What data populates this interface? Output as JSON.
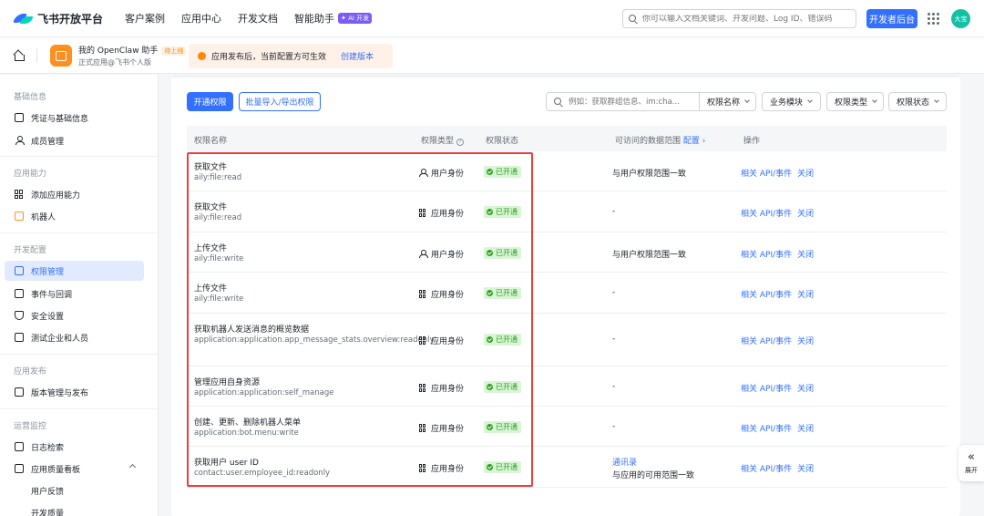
{
  "brand": {
    "name": "飞书开放平台"
  },
  "nav": {
    "items": [
      "客户案例",
      "应用中心",
      "开发文档",
      "智能助手"
    ],
    "ai_badge": "✦ AI 开发"
  },
  "search": {
    "placeholder": "你可以输入文档关键词、开发问题、Log ID、错误码"
  },
  "header": {
    "dev_console": "开发者后台",
    "avatar": "大宝"
  },
  "app": {
    "name": "我的 OpenClaw 助手",
    "tag": "待上线",
    "subtitle": "正式应用@飞书个人版"
  },
  "notice": {
    "text": "应用发布后，当前配置方可生效",
    "link": "创建版本"
  },
  "sidebar": {
    "groups": [
      "基础信息",
      "应用能力",
      "开发配置",
      "应用发布",
      "运营监控"
    ],
    "items": [
      "凭证与基础信息",
      "成员管理",
      "添加应用能力",
      "机器人",
      "权限管理",
      "事件与回调",
      "安全设置",
      "测试企业和人员",
      "版本管理与发布",
      "日志检索",
      "应用质量看板",
      "用户反馈",
      "开发质量"
    ]
  },
  "toolbar": {
    "enable": "开通权限",
    "batch": "批量导入/导出权限",
    "search_placeholder": "例如：获取群组信息、im:cha...",
    "search_scope": "权限名称",
    "filters": [
      "业务模块",
      "权限类型",
      "权限状态"
    ]
  },
  "table": {
    "headers": [
      "权限名称",
      "权限类型",
      "权限状态",
      "可访问的数据范围",
      "配置",
      "操作"
    ],
    "rows": [
      {
        "name": "获取文件",
        "code": "aily:file:read",
        "type": "用户身份",
        "status": "已开通",
        "scope": "与用户权限范围一致",
        "ops": [
          "相关 API/事件",
          "关闭"
        ]
      },
      {
        "name": "获取文件",
        "code": "aily:file:read",
        "type": "应用身份",
        "status": "已开通",
        "scope": "-",
        "ops": [
          "相关 API/事件",
          "关闭"
        ]
      },
      {
        "name": "上传文件",
        "code": "aily:file:write",
        "type": "用户身份",
        "status": "已开通",
        "scope": "与用户权限范围一致",
        "ops": [
          "相关 API/事件",
          "关闭"
        ]
      },
      {
        "name": "上传文件",
        "code": "aily:file:write",
        "type": "应用身份",
        "status": "已开通",
        "scope": "-",
        "ops": [
          "相关 API/事件",
          "关闭"
        ]
      },
      {
        "name": "获取机器人发送消息的概览数据",
        "code": "application:application.app_message_stats.overview:readonly",
        "type": "应用身份",
        "status": "已开通",
        "scope": "-",
        "ops": [
          "相关 API/事件",
          "关闭"
        ]
      },
      {
        "name": "管理应用自身资源",
        "code": "application:application:self_manage",
        "type": "应用身份",
        "status": "已开通",
        "scope": "-",
        "ops": [
          "相关 API/事件",
          "关闭"
        ]
      },
      {
        "name": "创建、更新、删除机器人菜单",
        "code": "application:bot.menu:write",
        "type": "应用身份",
        "status": "已开通",
        "scope": "-",
        "ops": [
          "相关 API/事件",
          "关闭"
        ]
      },
      {
        "name": "获取用户 user ID",
        "code": "contact:user.employee_id:readonly",
        "type": "应用身份",
        "status": "已开通",
        "scope_link": "通讯录",
        "scope": "与应用的可用范围一致",
        "ops": [
          "相关 API/事件",
          "关闭"
        ]
      }
    ]
  },
  "expand": {
    "label": "展开"
  },
  "icons": [
    "logo-icon",
    "search-icon",
    "apps-grid-icon",
    "home-icon",
    "warning-icon",
    "chevron-down-icon",
    "chevron-right-icon",
    "help-icon",
    "user-identity-icon",
    "app-identity-icon",
    "check-icon",
    "double-chevron-left-icon"
  ]
}
